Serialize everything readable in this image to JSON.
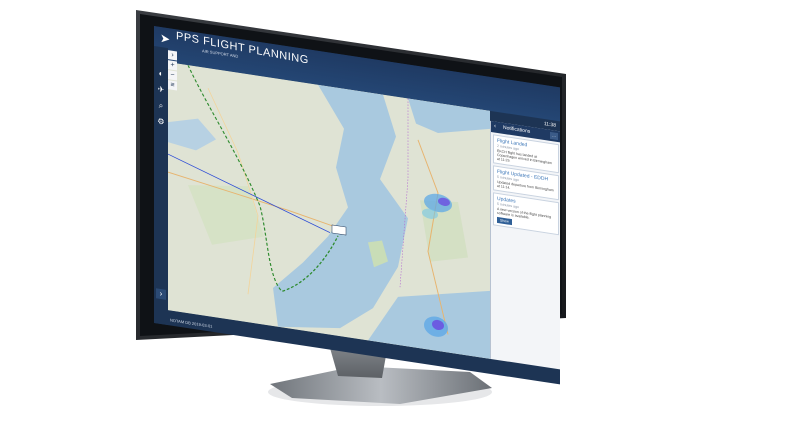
{
  "app": {
    "title": "PPS FLIGHT PLANNING",
    "subtitle": "AIR SUPPORT AND",
    "clock": "11:38",
    "status": "NOTAM DB 2019-03-01"
  },
  "toolbar": {
    "items": [
      {
        "icon": "weather-icon",
        "glyph": "◐"
      },
      {
        "icon": "airplane-icon",
        "glyph": "✈"
      },
      {
        "icon": "search-icon",
        "glyph": "⌕"
      },
      {
        "icon": "settings-icon",
        "glyph": "⚙"
      }
    ],
    "expand_glyph": "›"
  },
  "map_tools": {
    "collapse_glyph": "›",
    "zoom_in": "+",
    "zoom_out": "−",
    "layers": "≡"
  },
  "notifications": {
    "back_glyph": "‹",
    "title": "Notifications",
    "menu_glyph": "···",
    "items": [
      {
        "title": "Flight Landed",
        "sub": "2 minutes ago",
        "body": "EKCH flight has landed at Copenhagen arrived in Birmingham at 11:29."
      },
      {
        "title": "Flight Updated - EDDH",
        "sub": "5 minutes ago",
        "body": "Updated departure from Birmingham at 11:14."
      },
      {
        "title": "Updates",
        "sub": "5 minutes ago",
        "body": "A new version of the flight planning software is available.",
        "button": "Show"
      }
    ]
  },
  "colors": {
    "header": "#1f3a63",
    "route_green": "#2e8b2e",
    "route_blue": "#2c4bd6",
    "water": "#a9c9df",
    "land": "#dfe3d4"
  }
}
